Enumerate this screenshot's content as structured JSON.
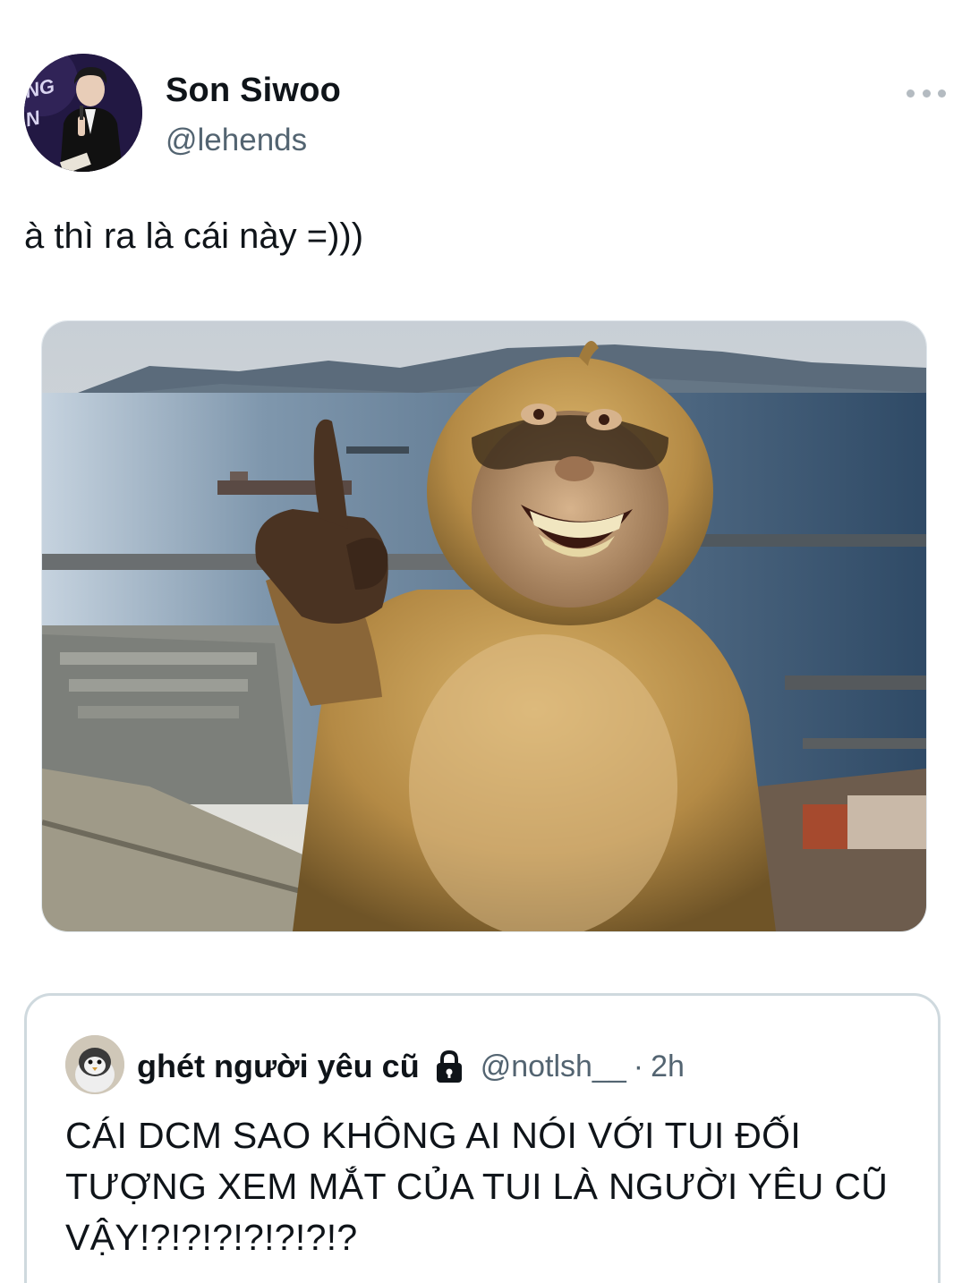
{
  "author": {
    "display_name": "Son Siwoo",
    "handle": "@lehends",
    "avatar_text": "NG N"
  },
  "tweet": {
    "text": "à thì ra là cái này =)))"
  },
  "media": {
    "description_icon": "monkey-photo"
  },
  "quote": {
    "display_name": "ghét người yêu cũ",
    "handle": "@notlsh__",
    "separator": "·",
    "time": "2h",
    "text": "CÁI DCM SAO KHÔNG AI NÓI VỚI TUI ĐỐI TƯỢNG XEM MẮT CỦA TUI LÀ NGƯỜI YÊU CŨ VẬY!?!?!?!?!?!?!?"
  },
  "icons": {
    "more": "more-horizontal-icon",
    "lock": "lock-icon"
  },
  "colors": {
    "text_primary": "#0f1419",
    "text_secondary": "#536471",
    "border": "#cfd9de"
  }
}
